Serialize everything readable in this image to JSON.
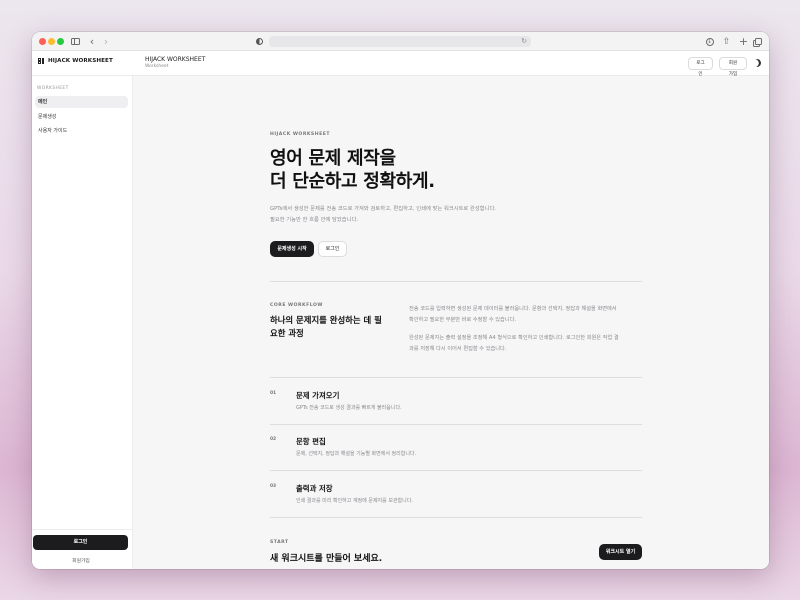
{
  "browser": {
    "icons": [
      "sidebar-icon",
      "chevron-left-icon",
      "chevron-right-icon",
      "shield-icon",
      "reload-icon",
      "download-icon",
      "share-icon",
      "plus-icon",
      "tabs-icon"
    ]
  },
  "header": {
    "brand": "HIJACK WORKSHEET",
    "title": "HIJACK WORKSHEET",
    "subtitle": "Worksheet",
    "login_label": "로그인",
    "signup_label": "회원가입"
  },
  "sidebar": {
    "section_label": "WORKSHEET",
    "items": [
      {
        "label": "메인",
        "active": true
      },
      {
        "label": "문제생성",
        "active": false
      },
      {
        "label": "사용자 가이드",
        "active": false
      }
    ],
    "login_label": "로그인",
    "signup_label": "회원가입"
  },
  "hero": {
    "eyebrow": "HIJACK WORKSHEET",
    "title_line1": "영어 문제 제작을",
    "title_line2": "더 단순하고 정확하게.",
    "desc_line1": "GPTs에서 생성한 문제를 전송 코드로 가져와 검토하고, 편집하고, 인쇄에 맞는 워크시트로 완성합니다.",
    "desc_line2": "필요한 기능만 한 흐름 안에 담았습니다.",
    "primary_label": "문제생성 시작",
    "secondary_label": "로그인"
  },
  "workflow": {
    "eyebrow": "CORE WORKFLOW",
    "title_line1": "하나의 문제지를 완성하는 데 필",
    "title_line2": "요한 과정",
    "para1_line1": "전송 코드를 입력하면 생성된 문제 데이터를 불러옵니다. 문항과 선택지, 정답과 해설을 화면에서",
    "para1_line2": "확인하고 필요한 부분만 바로 수정할 수 있습니다.",
    "para2_line1": "완성된 문제지는 출력 설정을 조정해 A4 형식으로 확인하고 인쇄합니다. 로그인한 회원은 작업 결",
    "para2_line2": "과를 저장해 다시 이어서 편집할 수 있습니다."
  },
  "steps": [
    {
      "num": "01",
      "title": "문제 가져오기",
      "desc": "GPTs 전송 코드로 생성 결과를 빠르게 불러옵니다."
    },
    {
      "num": "02",
      "title": "문항 편집",
      "desc": "문제, 선택지, 정답과 해설을 기능별 화면에서 정리합니다."
    },
    {
      "num": "03",
      "title": "출력과 저장",
      "desc": "인쇄 결과를 미리 확인하고 계정에 문제지를 보관합니다."
    }
  ],
  "cta": {
    "eyebrow": "START",
    "title": "새 워크시트를 만들어 보세요.",
    "button_label": "워크시트 열기"
  }
}
